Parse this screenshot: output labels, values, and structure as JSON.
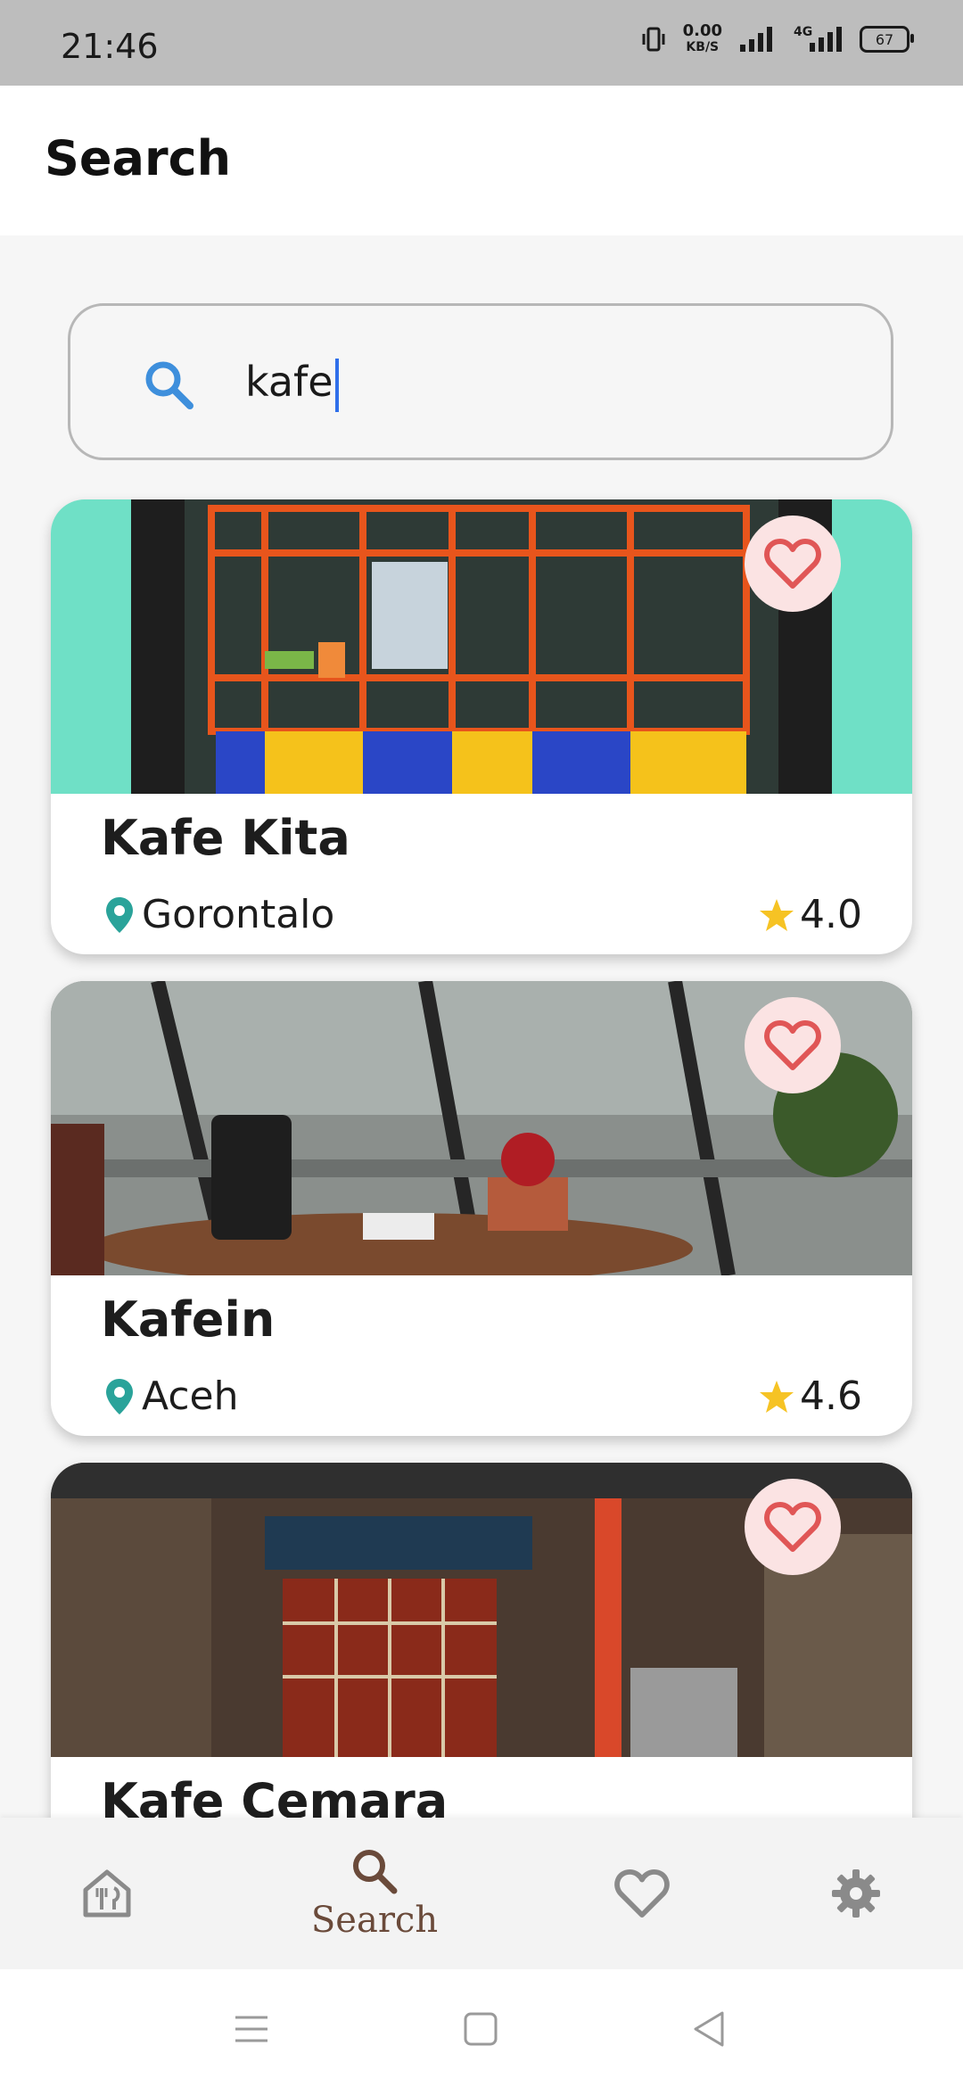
{
  "status_bar": {
    "time": "21:46",
    "net_speed_value": "0.00",
    "net_speed_unit": "KB/S",
    "network_type": "4G",
    "battery": "67"
  },
  "header": {
    "title": "Search"
  },
  "search": {
    "value": "kafe",
    "icon": "search-icon"
  },
  "restaurants": [
    {
      "name": "Kafe Kita",
      "location": "Gorontalo",
      "rating": "4.0"
    },
    {
      "name": "Kafein",
      "location": "Aceh",
      "rating": "4.6"
    },
    {
      "name": "Kafe Cemara"
    }
  ],
  "bottom_nav": {
    "items": [
      {
        "icon": "restaurant-home-icon",
        "label": ""
      },
      {
        "icon": "search-icon",
        "label": "Search",
        "active": true
      },
      {
        "icon": "heart-icon",
        "label": ""
      },
      {
        "icon": "gear-icon",
        "label": ""
      }
    ]
  },
  "colors": {
    "accent": "#6a4a3a",
    "search_icon": "#3e8fdc",
    "location_pin": "#2aa39a",
    "star": "#f6c324",
    "favorite": "#e05656"
  }
}
